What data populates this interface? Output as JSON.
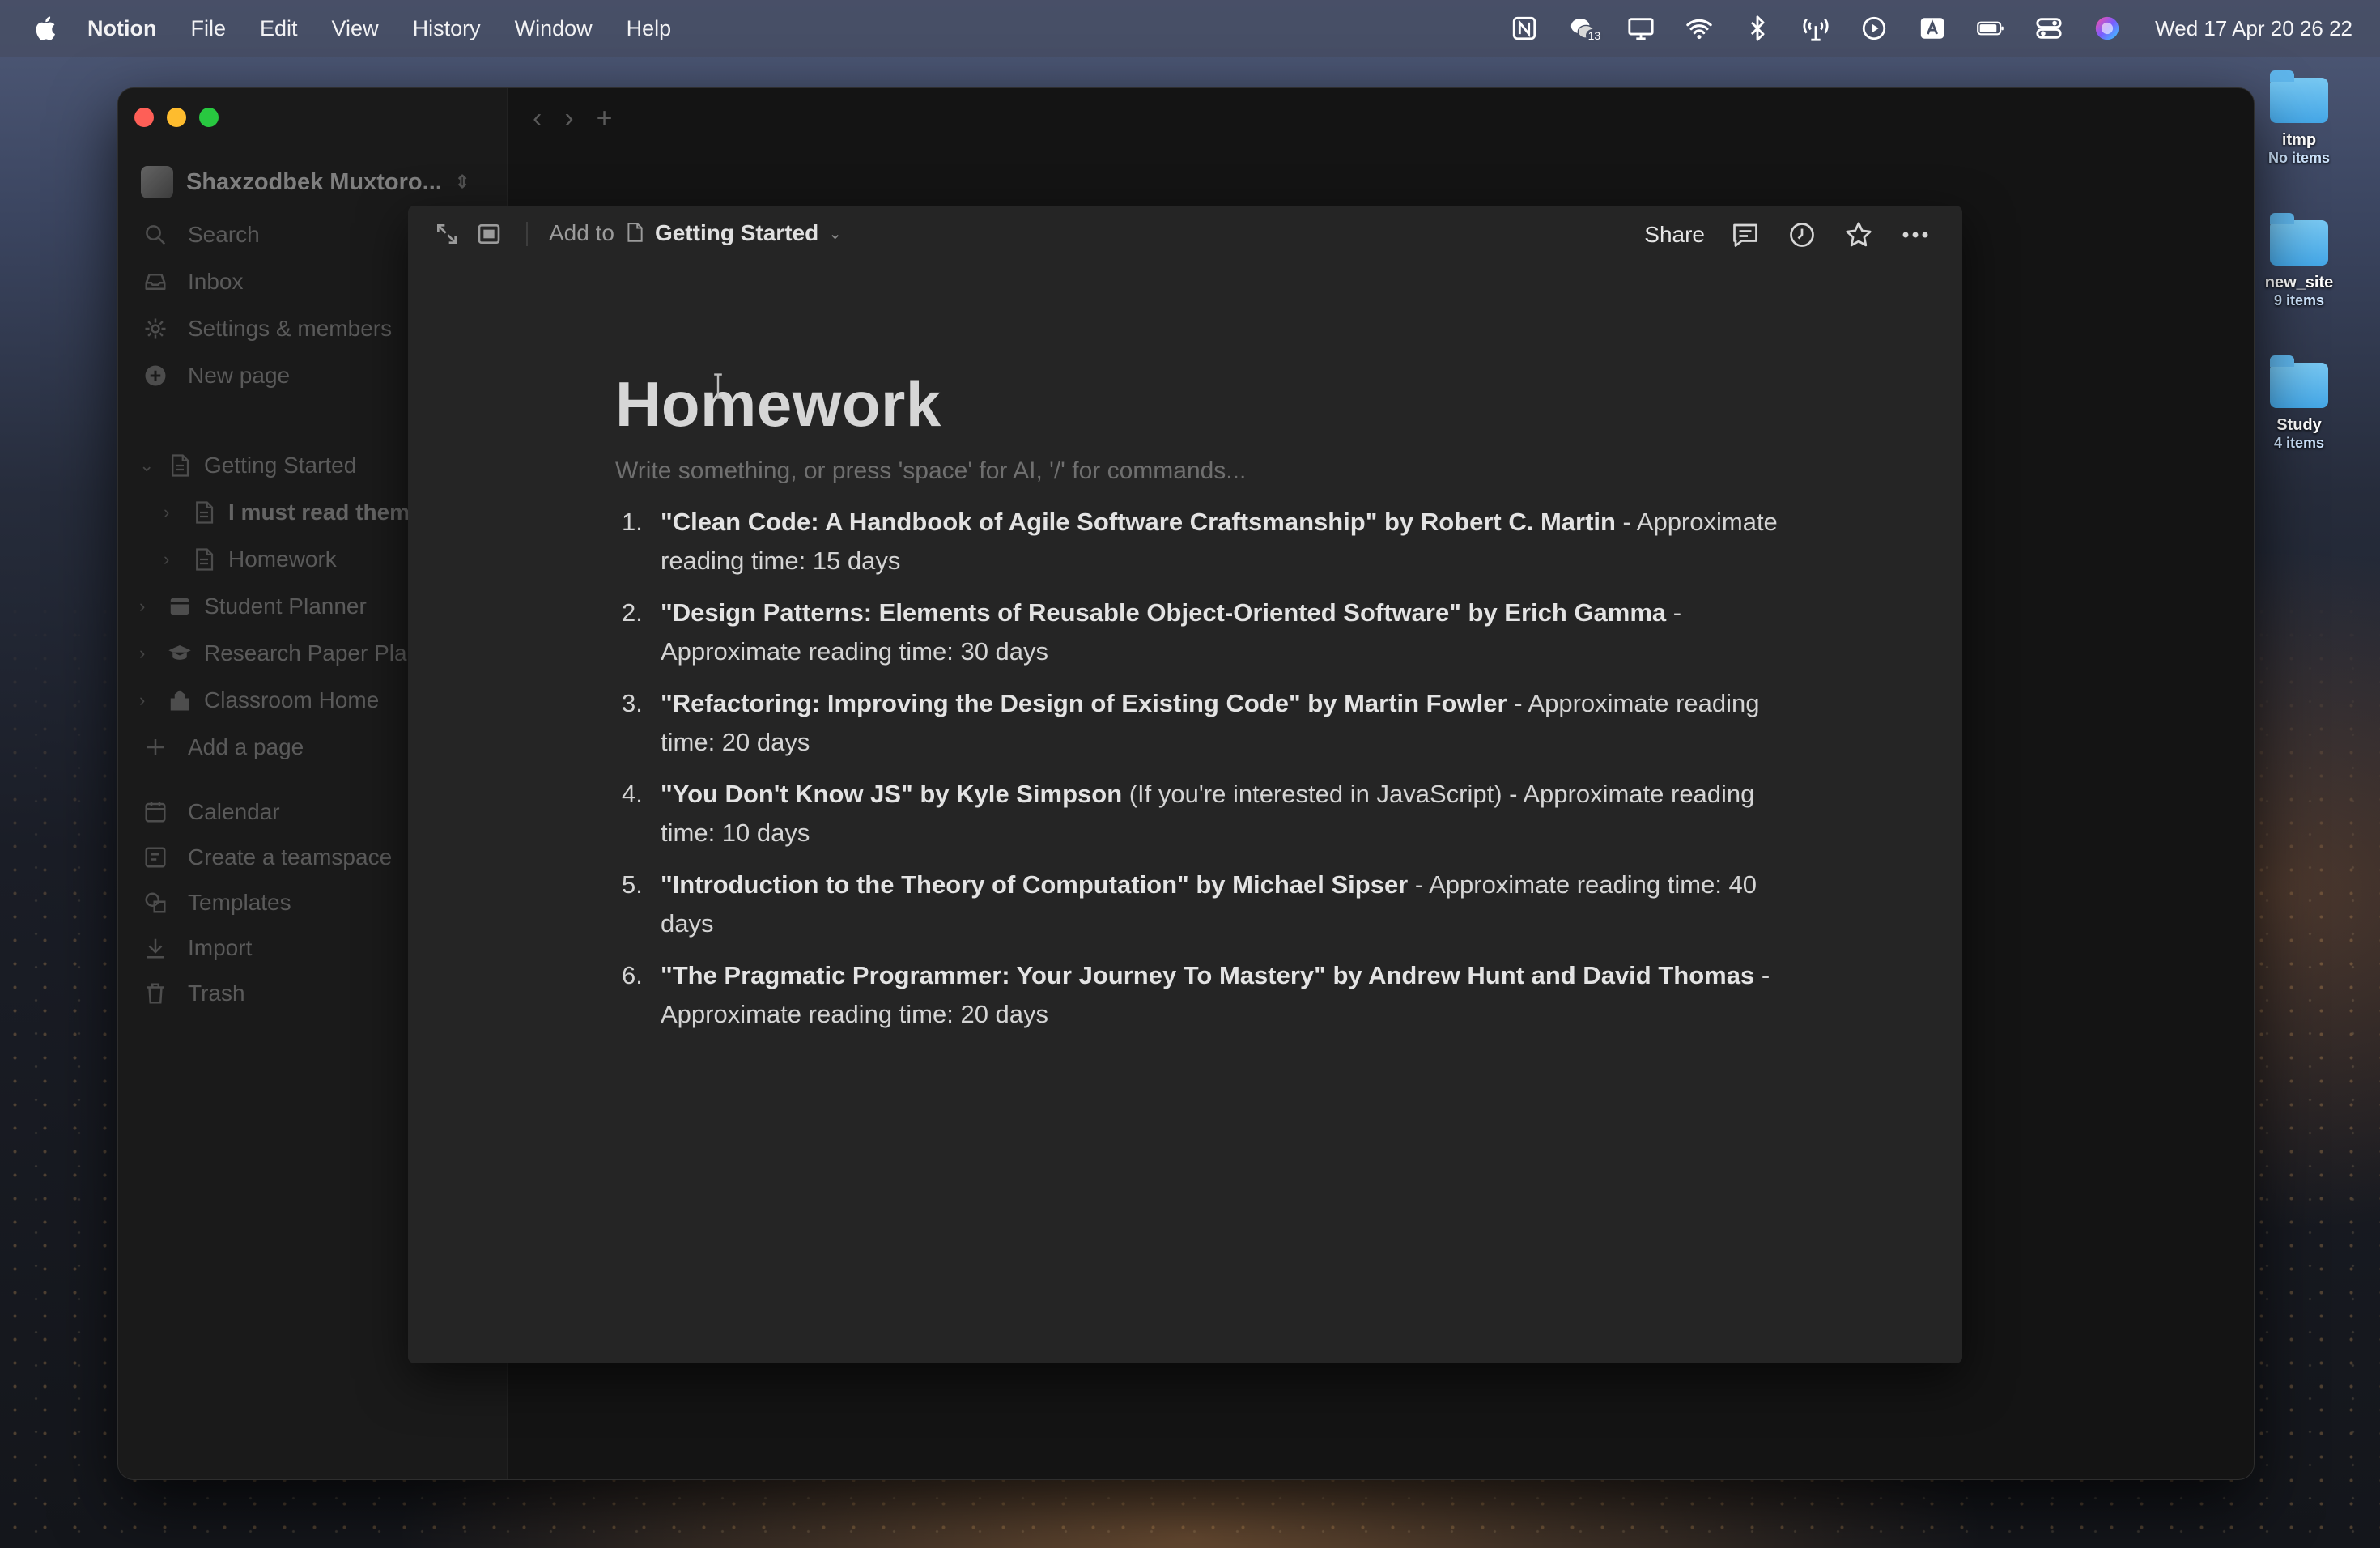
{
  "menubar": {
    "app_name": "Notion",
    "menus": [
      "File",
      "Edit",
      "View",
      "History",
      "Window",
      "Help"
    ],
    "clock": "Wed 17 Apr  20 26 22",
    "status_icons": [
      "notion-icon",
      "wechat-icon",
      "display-icon",
      "wifi-icon",
      "bluetooth-icon",
      "antenna-icon",
      "play-icon",
      "keyboard-a-icon",
      "battery-icon",
      "control-center-icon",
      "siri-icon"
    ],
    "badge_count": "13"
  },
  "desktop": {
    "folders": [
      {
        "name": "itmp",
        "count": "No items"
      },
      {
        "name": "new_site",
        "count": "9 items"
      },
      {
        "name": "Study",
        "count": "4 items"
      }
    ]
  },
  "sidebar": {
    "workspace": "Shaxzodbek Muxtoro...",
    "search": "Search",
    "inbox": "Inbox",
    "settings": "Settings & members",
    "new_page": "New page",
    "pages": {
      "getting_started": "Getting Started",
      "must_read": "I must read them",
      "homework": "Homework",
      "student_planner": "Student Planner",
      "research_paper": "Research Paper Pla",
      "classroom_home": "Classroom Home",
      "add_page": "Add a page"
    },
    "calendar": "Calendar",
    "create_teamspace": "Create a teamspace",
    "templates": "Templates",
    "import": "Import",
    "trash": "Trash"
  },
  "peek": {
    "add_to": "Add to",
    "parent_page": "Getting Started",
    "share": "Share"
  },
  "document": {
    "title": "Homework",
    "placeholder": "Write something, or press 'space' for AI, '/' for commands...",
    "items": [
      {
        "num": "1.",
        "bold": "\"Clean Code: A Handbook of Agile Software Craftsmanship\" by Robert C. Martin",
        "rest": " - Approximate reading time: 15 days"
      },
      {
        "num": "2.",
        "bold": "\"Design Patterns: Elements of Reusable Object-Oriented Software\" by Erich Gamma",
        "rest": " - Approximate reading time: 30 days"
      },
      {
        "num": "3.",
        "bold": "\"Refactoring: Improving the Design of Existing Code\" by Martin Fowler",
        "rest": " - Approximate reading time: 20 days"
      },
      {
        "num": "4.",
        "bold": "\"You Don't Know JS\" by Kyle Simpson",
        "rest": " (If you're interested in JavaScript) - Approximate reading time: 10 days"
      },
      {
        "num": "5.",
        "bold": "\"Introduction to the Theory of Computation\" by Michael Sipser",
        "rest": " - Approximate reading time: 40 days"
      },
      {
        "num": "6.",
        "bold": "\"The Pragmatic Programmer: Your Journey To Mastery\" by Andrew Hunt and David Thomas",
        "rest": " - Approximate reading time: 20 days"
      }
    ]
  }
}
